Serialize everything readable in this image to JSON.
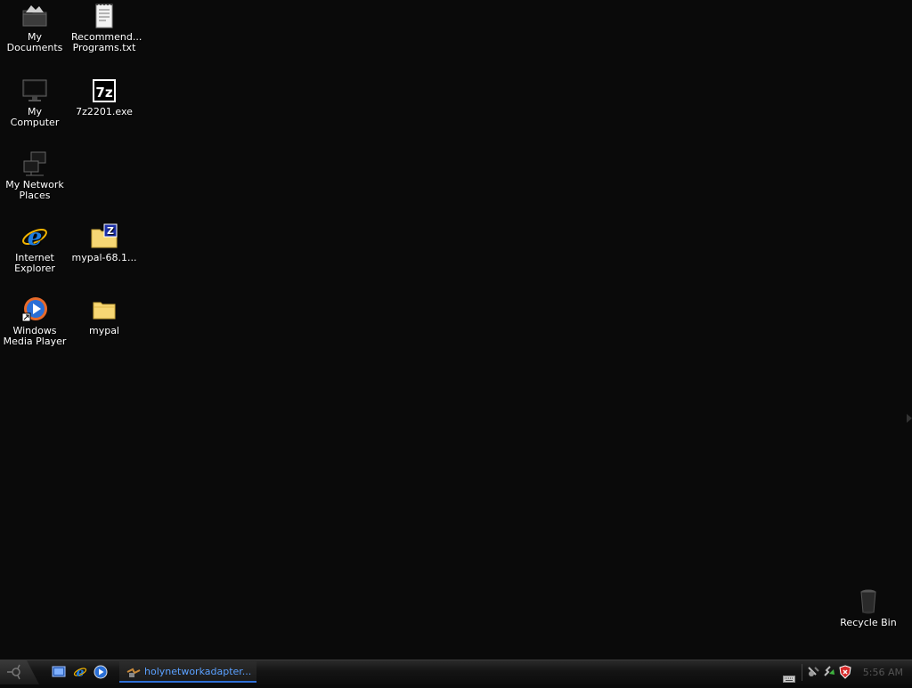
{
  "desktop": {
    "icons": [
      {
        "label": "My Documents",
        "icon": "folder-documents-icon"
      },
      {
        "label": "Recommend... Programs.txt",
        "icon": "text-file-icon"
      },
      {
        "label": "My Computer",
        "icon": "monitor-icon"
      },
      {
        "label": "7z2201.exe",
        "icon": "7zip-icon"
      },
      {
        "label": "My Network Places",
        "icon": "network-icon"
      },
      {
        "label": "Internet Explorer",
        "icon": "internet-explorer-icon"
      },
      {
        "label": "mypal-68.1...",
        "icon": "zip-folder-icon"
      },
      {
        "label": "Windows Media Player",
        "icon": "media-player-icon"
      },
      {
        "label": "mypal",
        "icon": "folder-icon"
      },
      {
        "label": "Recycle Bin",
        "icon": "recycle-bin-icon"
      }
    ]
  },
  "taskbar": {
    "active_task": "holynetworkadapter...",
    "clock": "5:56 AM"
  },
  "colors": {
    "background": "#0a0a0a",
    "task_text": "#5aa0ff",
    "task_underline": "#2f6fd6",
    "clock": "#555555"
  }
}
